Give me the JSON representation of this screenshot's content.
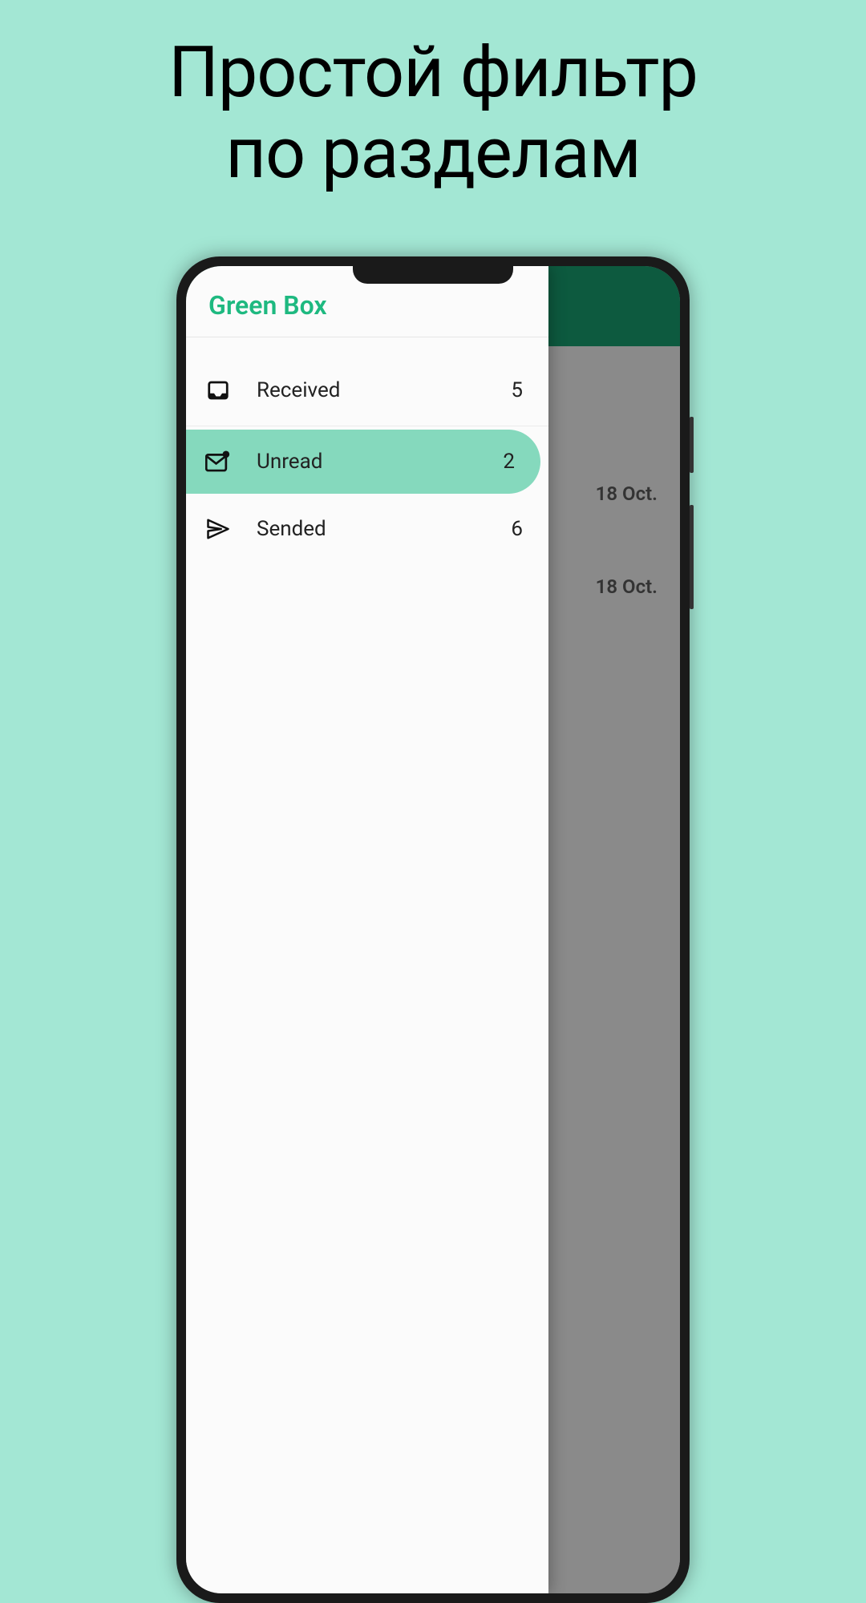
{
  "promo": {
    "title_line1": "Простой фильтр",
    "title_line2": "по разделам"
  },
  "app": {
    "title": "Green Box"
  },
  "drawer": {
    "items": [
      {
        "label": "Received",
        "count": "5",
        "icon": "inbox",
        "selected": false
      },
      {
        "label": "Unread",
        "count": "2",
        "icon": "mail-unread",
        "selected": true
      },
      {
        "label": "Sended",
        "count": "6",
        "icon": "send",
        "selected": false
      }
    ]
  },
  "background": {
    "dates": [
      "18 Oct.",
      "18 Oct."
    ]
  },
  "colors": {
    "promo_bg": "#a3e7d4",
    "accent": "#1eb980",
    "selected_bg": "#85d9bd",
    "header_bg": "#0d5a3f"
  }
}
